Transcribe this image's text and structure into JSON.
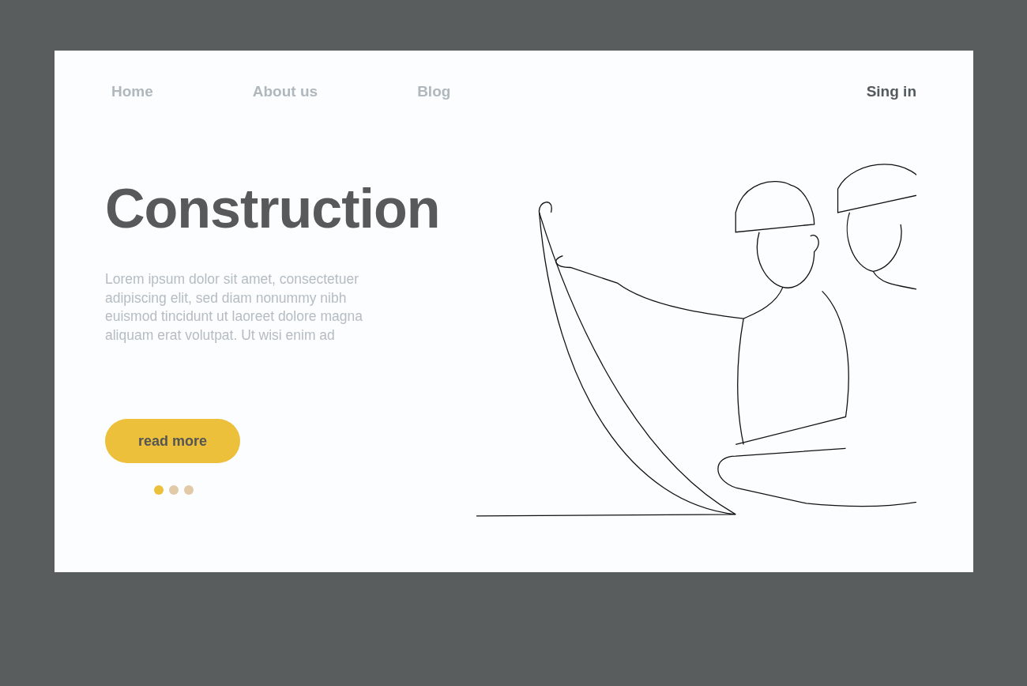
{
  "nav": {
    "links": [
      {
        "label": "Home"
      },
      {
        "label": "About us"
      },
      {
        "label": "Blog"
      }
    ],
    "sign_in": "Sing in"
  },
  "hero": {
    "title": "Construction",
    "text": "Lorem ipsum dolor sit amet, consectetuer adipiscing elit, sed diam nonummy nibh euismod tincidunt ut laoreet dolore magna aliquam erat volutpat. Ut wisi enim ad",
    "button": "read more"
  },
  "pager": [
    {
      "selected": true
    },
    {
      "selected": false
    },
    {
      "selected": false
    }
  ]
}
